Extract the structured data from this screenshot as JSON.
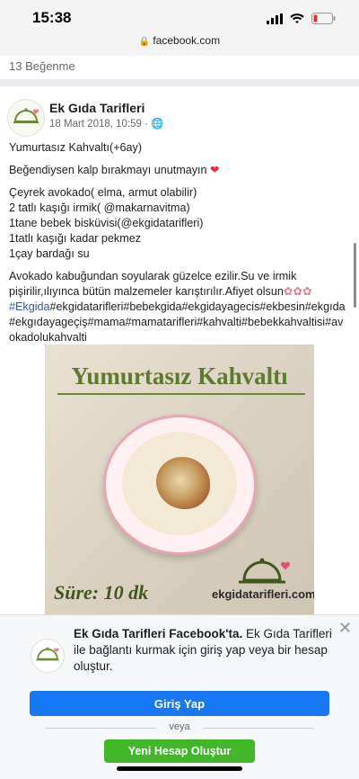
{
  "status": {
    "time": "15:38",
    "url": "facebook.com"
  },
  "likes": "13 Beğenme",
  "post": {
    "author": "Ek Gıda Tarifleri",
    "date": "18 Mart 2018, 10:59 · ",
    "title_line": "Yumurtasız Kahvaltı(+6ay)",
    "like_line": "Beğendiysen kalp bırakmayı unutmayın",
    "ingredients": [
      "Çeyrek avokado( elma, armut olabilir)",
      "2 tatlı kaşığı irmik( @makarnavitma)",
      "1tane bebek bisküvisi(@ekgidatarifleri)",
      "1tatlı kaşığı kadar pekmez",
      "1çay bardağı su"
    ],
    "instructions": "Avokado kabuğundan soyularak güzelce ezilir.Su ve irmik pişirilir,ılıyınca bütün malzemeler karıştırılır.Afiyet olsun",
    "hashtag_link": "#Ekgida",
    "hashtags": "#ekgidatarifleri#bebekgida#ekgidayagecis#ekbesin#ekgıda#ekgıdayageçiş#mama#mamatarifleri#kahvalti#bebekkahvaltisi#avokadolukahvalti",
    "image": {
      "title": "Yumurtasız Kahvaltı",
      "duration": "Süre: 10 dk",
      "site": "ekgidatarifleri.com"
    }
  },
  "login_panel": {
    "bold_text": "Ek Gıda Tarifleri Facebook'ta.",
    "text": " Ek Gıda Tarifleri ile bağlantı kurmak için giriş yap veya bir hesap oluştur.",
    "login_button": "Giriş Yap",
    "or_text": "veya",
    "signup_button": "Yeni Hesap Oluştur"
  },
  "colors": {
    "facebook_blue": "#1877f2",
    "signup_green": "#42b72a",
    "link": "#385898",
    "heart": "#e0323e"
  },
  "icons": [
    "signal-icon",
    "wifi-icon",
    "battery-icon",
    "lock-icon",
    "globe-icon",
    "heart-icon",
    "flower-emoji-icon",
    "close-icon",
    "cloche-logo-icon"
  ]
}
